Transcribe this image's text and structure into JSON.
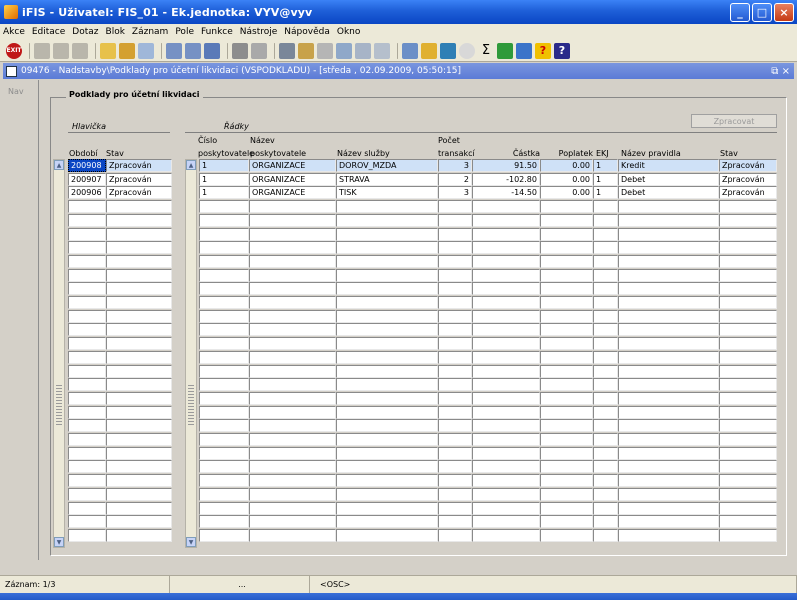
{
  "app": {
    "title": "iFIS - Uživatel: FIS_01 - Ek.jednotka: VYV@vyv"
  },
  "menu": [
    "Akce",
    "Editace",
    "Dotaz",
    "Blok",
    "Záznam",
    "Pole",
    "Funkce",
    "Nástroje",
    "Nápověda",
    "Okno"
  ],
  "form": {
    "title": "09476 - Nadstavby\\Podklady pro účetní likvidaci (VSPODKLADU) - [středa , 02.09.2009, 05:50:15]",
    "nav_label": "Nav",
    "frame_title": "Podklady pro účetní likvidaci",
    "button_label": "Zpracovat"
  },
  "header_block": {
    "label": "Hlavička",
    "columns": [
      "Období",
      "Stav"
    ],
    "rows": [
      {
        "obdobi": "200908",
        "stav": "Zpracován"
      },
      {
        "obdobi": "200907",
        "stav": "Zpracován"
      },
      {
        "obdobi": "200906",
        "stav": "Zpracován"
      }
    ]
  },
  "detail_block": {
    "label": "Řádky",
    "columns": {
      "cislo": "Číslo poskytovatele",
      "cislo_1": "Číslo",
      "cislo_2": "poskytovatele",
      "nazev_1": "Název",
      "nazev_2": "poskytovatele",
      "sluzba": "Název služby",
      "pocet_1": "Počet",
      "pocet_2": "transakcí",
      "castka": "Částka",
      "poplatek": "Poplatek",
      "ekj": "EKJ",
      "pravidlo": "Název pravidla",
      "stav": "Stav"
    },
    "rows": [
      {
        "cislo": "1",
        "nazev": "ORGANIZACE",
        "sluzba": "DOROV_MZDA",
        "pocet": "3",
        "castka": "91.50",
        "poplatek": "0.00",
        "ekj": "1",
        "pravidlo": "Kredit",
        "stav": "Zpracován"
      },
      {
        "cislo": "1",
        "nazev": "ORGANIZACE",
        "sluzba": "STRAVA",
        "pocet": "2",
        "castka": "-102.80",
        "poplatek": "0.00",
        "ekj": "1",
        "pravidlo": "Debet",
        "stav": "Zpracován"
      },
      {
        "cislo": "1",
        "nazev": "ORGANIZACE",
        "sluzba": "TISK",
        "pocet": "3",
        "castka": "-14.50",
        "poplatek": "0.00",
        "ekj": "1",
        "pravidlo": "Debet",
        "stav": "Zpracován"
      }
    ]
  },
  "status": {
    "record": "Záznam: 1/3",
    "dots": "...",
    "mode": "<OSC>"
  }
}
